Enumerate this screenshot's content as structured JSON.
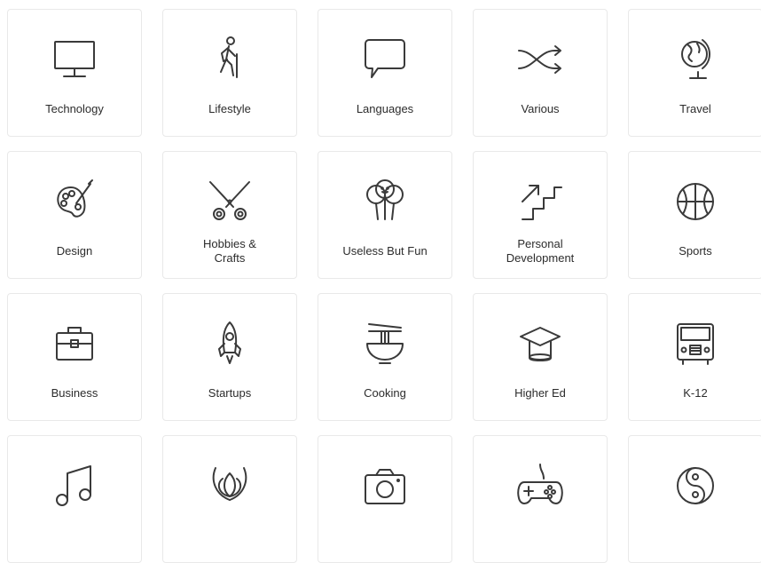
{
  "categories": [
    {
      "label": "Technology",
      "icon": "monitor-icon"
    },
    {
      "label": "Lifestyle",
      "icon": "hiker-icon"
    },
    {
      "label": "Languages",
      "icon": "speech-bubble-icon"
    },
    {
      "label": "Various",
      "icon": "shuffle-icon"
    },
    {
      "label": "Travel",
      "icon": "globe-icon"
    },
    {
      "label": "Design",
      "icon": "palette-icon"
    },
    {
      "label": "Hobbies &\nCrafts",
      "icon": "scissors-icon"
    },
    {
      "label": "Useless But Fun",
      "icon": "balloons-icon"
    },
    {
      "label": "Personal\nDevelopment",
      "icon": "stairs-icon"
    },
    {
      "label": "Sports",
      "icon": "basketball-icon"
    },
    {
      "label": "Business",
      "icon": "briefcase-icon"
    },
    {
      "label": "Startups",
      "icon": "rocket-icon"
    },
    {
      "label": "Cooking",
      "icon": "noodle-bowl-icon"
    },
    {
      "label": "Higher Ed",
      "icon": "graduation-cap-icon"
    },
    {
      "label": "K-12",
      "icon": "school-bus-icon"
    },
    {
      "label": "",
      "icon": "music-note-icon"
    },
    {
      "label": "",
      "icon": "tulip-icon"
    },
    {
      "label": "",
      "icon": "camera-icon"
    },
    {
      "label": "",
      "icon": "gamepad-icon"
    },
    {
      "label": "",
      "icon": "yin-yang-icon"
    }
  ]
}
